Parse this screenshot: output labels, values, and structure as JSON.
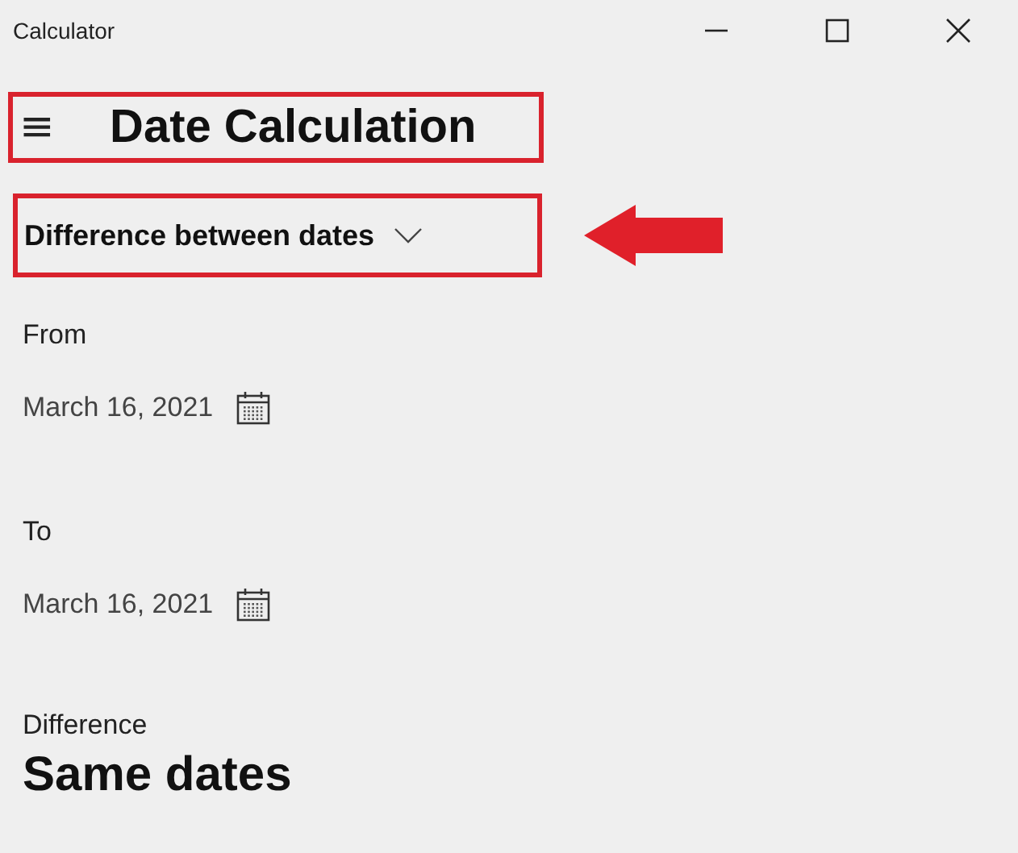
{
  "window": {
    "title": "Calculator"
  },
  "header": {
    "menu_icon": "≡",
    "title": "Date Calculation"
  },
  "mode_dropdown": {
    "value": "Difference between dates"
  },
  "from": {
    "label": "From",
    "date": "March 16, 2021"
  },
  "to": {
    "label": "To",
    "date": "March 16, 2021"
  },
  "difference": {
    "label": "Difference",
    "value": "Same dates"
  }
}
